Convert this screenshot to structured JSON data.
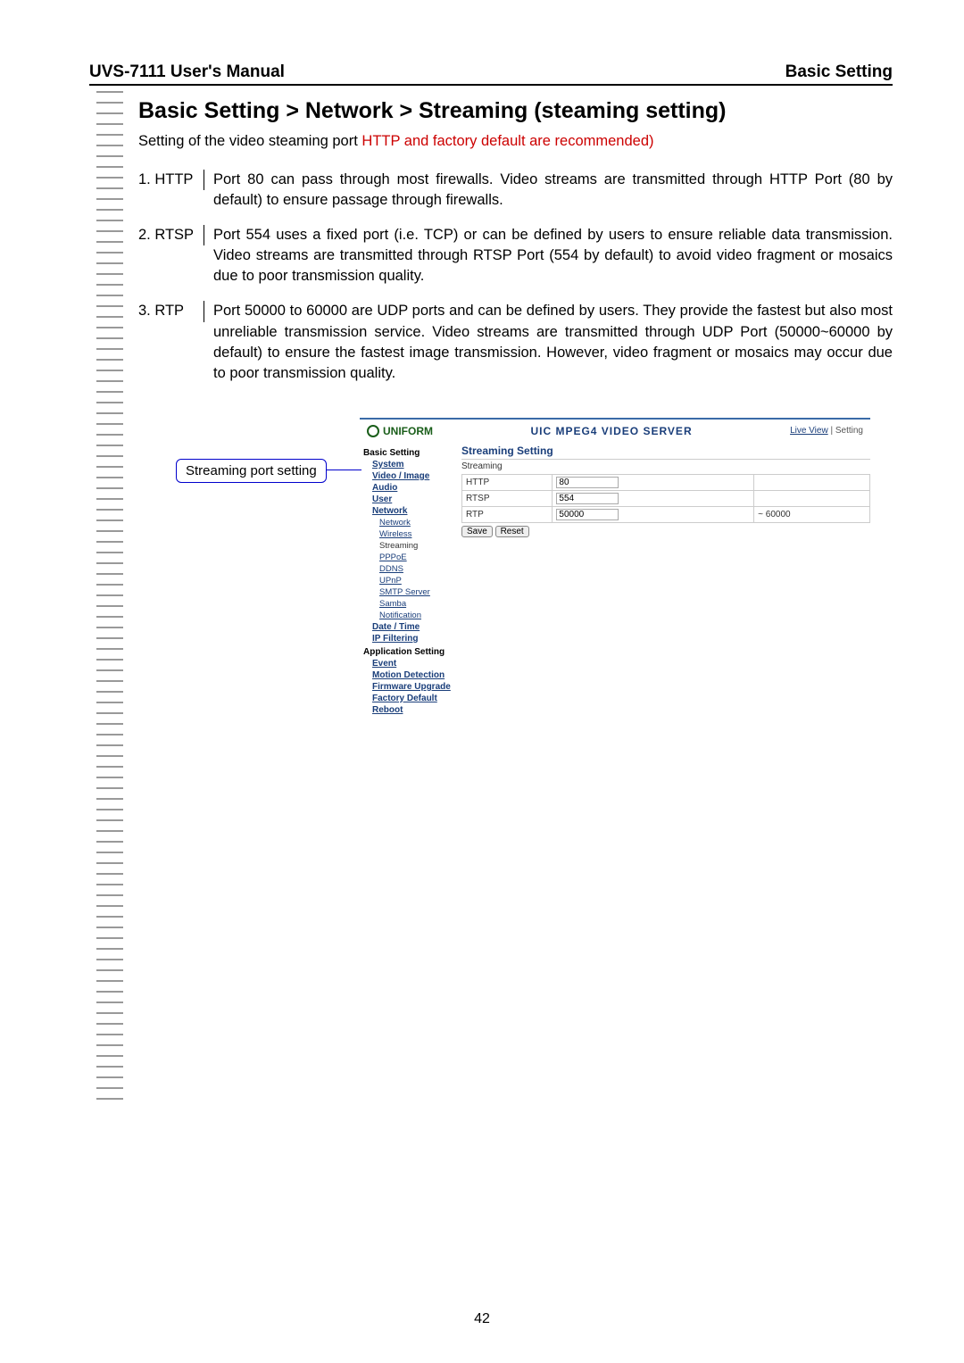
{
  "header": {
    "left": "UVS-7111 User's Manual",
    "right": "Basic Setting"
  },
  "title": "Basic Setting > Network > Streaming (steaming setting)",
  "subtitle_black": "Setting of the video steaming port ",
  "subtitle_red": "HTTP and factory default are recommended)",
  "defs": [
    {
      "label": "1. HTTP",
      "text": "Port 80 can pass through most firewalls. Video streams are transmitted through HTTP Port (80 by default) to ensure passage through firewalls."
    },
    {
      "label": "2. RTSP",
      "text": "Port 554 uses a fixed port (i.e. TCP) or can be defined by users to ensure reliable data transmission. Video streams are transmitted through RTSP Port (554 by default) to avoid video fragment or mosaics due to poor transmission quality."
    },
    {
      "label": "3. RTP",
      "text": "Port 50000 to 60000 are UDP ports and can be defined by users. They provide the fastest but also most unreliable transmission service. Video streams are transmitted through UDP Port (50000~60000 by default) to ensure the fastest image transmission. However, video fragment or mosaics may occur due to poor transmission quality."
    }
  ],
  "callout": "Streaming port setting",
  "app": {
    "brand": "UNIFORM",
    "server_title": "UIC MPEG4 VIDEO SERVER",
    "top_links": {
      "live": "Live View",
      "sep": " | ",
      "setting": "Setting"
    },
    "sidebar": {
      "group1": "Basic Setting",
      "items1": [
        "System",
        "Video / Image",
        "Audio",
        "User",
        "Network"
      ],
      "network_sub": [
        "Network",
        "Wireless",
        "Streaming",
        "PPPoE",
        "DDNS",
        "UPnP",
        "SMTP Server",
        "Samba",
        "Notification"
      ],
      "items2": [
        "Date / Time",
        "IP Filtering"
      ],
      "group2": "Application Setting",
      "items3": [
        "Event",
        "Motion Detection",
        "Firmware Upgrade",
        "Factory Default",
        "Reboot"
      ]
    },
    "panel": {
      "title": "Streaming Setting",
      "subtitle": "Streaming",
      "rows": [
        {
          "name": "HTTP",
          "v1": "80",
          "v2": ""
        },
        {
          "name": "RTSP",
          "v1": "554",
          "v2": ""
        },
        {
          "name": "RTP",
          "v1": "50000",
          "v2": "~ 60000"
        }
      ],
      "save": "Save",
      "reset": "Reset"
    }
  },
  "page_number": "42"
}
